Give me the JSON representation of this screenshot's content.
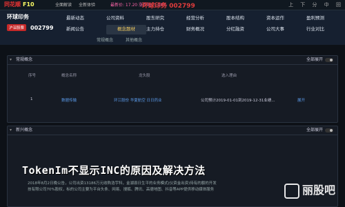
{
  "topbar": {
    "logo": "同花顺",
    "logo_suffix": "F10",
    "links": [
      "全面解读",
      "全新体验"
    ],
    "status": "最新价: 17.20 涨跌幅: 1.18%",
    "title": "环球印务 002799",
    "icons": [
      "上",
      "下",
      "分",
      "中",
      "回"
    ]
  },
  "stock": {
    "name": "环球印务",
    "badge": "沪深股票",
    "code": "002799"
  },
  "nav": {
    "items": [
      "最新动态",
      "公司资料",
      "股东研究",
      "经营分析",
      "股本结构",
      "资本运作",
      "盈利预测",
      "新闻公告",
      "概念题材",
      "主力持仓",
      "财务概况",
      "分红融资",
      "公司大事",
      "行业对比"
    ],
    "active_index": 8
  },
  "subtabs": [
    "常规概念",
    "其他概念"
  ],
  "section1": {
    "title": "常规概念",
    "toggle_label": "全部展开",
    "headers": [
      "序号",
      "概念名称",
      "龙头股",
      "选入理由"
    ],
    "row": {
      "index": "1",
      "name": "数据传输",
      "leaders": "环江股份 华夏航空 日日药业",
      "reason": "公司预计2019-01-01到2019-12-31业绩...",
      "expand": "展开"
    }
  },
  "section2": {
    "title": "新兴概念",
    "toggle_label": "全部展开"
  },
  "footer_lines": [
    "2018年8月2日晚公告，公司出资13186万元收购浩宇科，金湖县日生平的业务模式(仪资金出资)待有的额的开发",
    "技有限公司70%股权，标的公司主要为平台头条、网易、搜狐、腾讯、高德地图、抖音等APP提供移动媒体服务"
  ],
  "overlay_title": "TokenIm不显示INC的原因及解决方法",
  "watermark": "丽股吧",
  "colors": {
    "background": "#0d1117",
    "accent": "#e03c3c",
    "active_tab": "#f0c95e",
    "link": "#5b9bea"
  }
}
